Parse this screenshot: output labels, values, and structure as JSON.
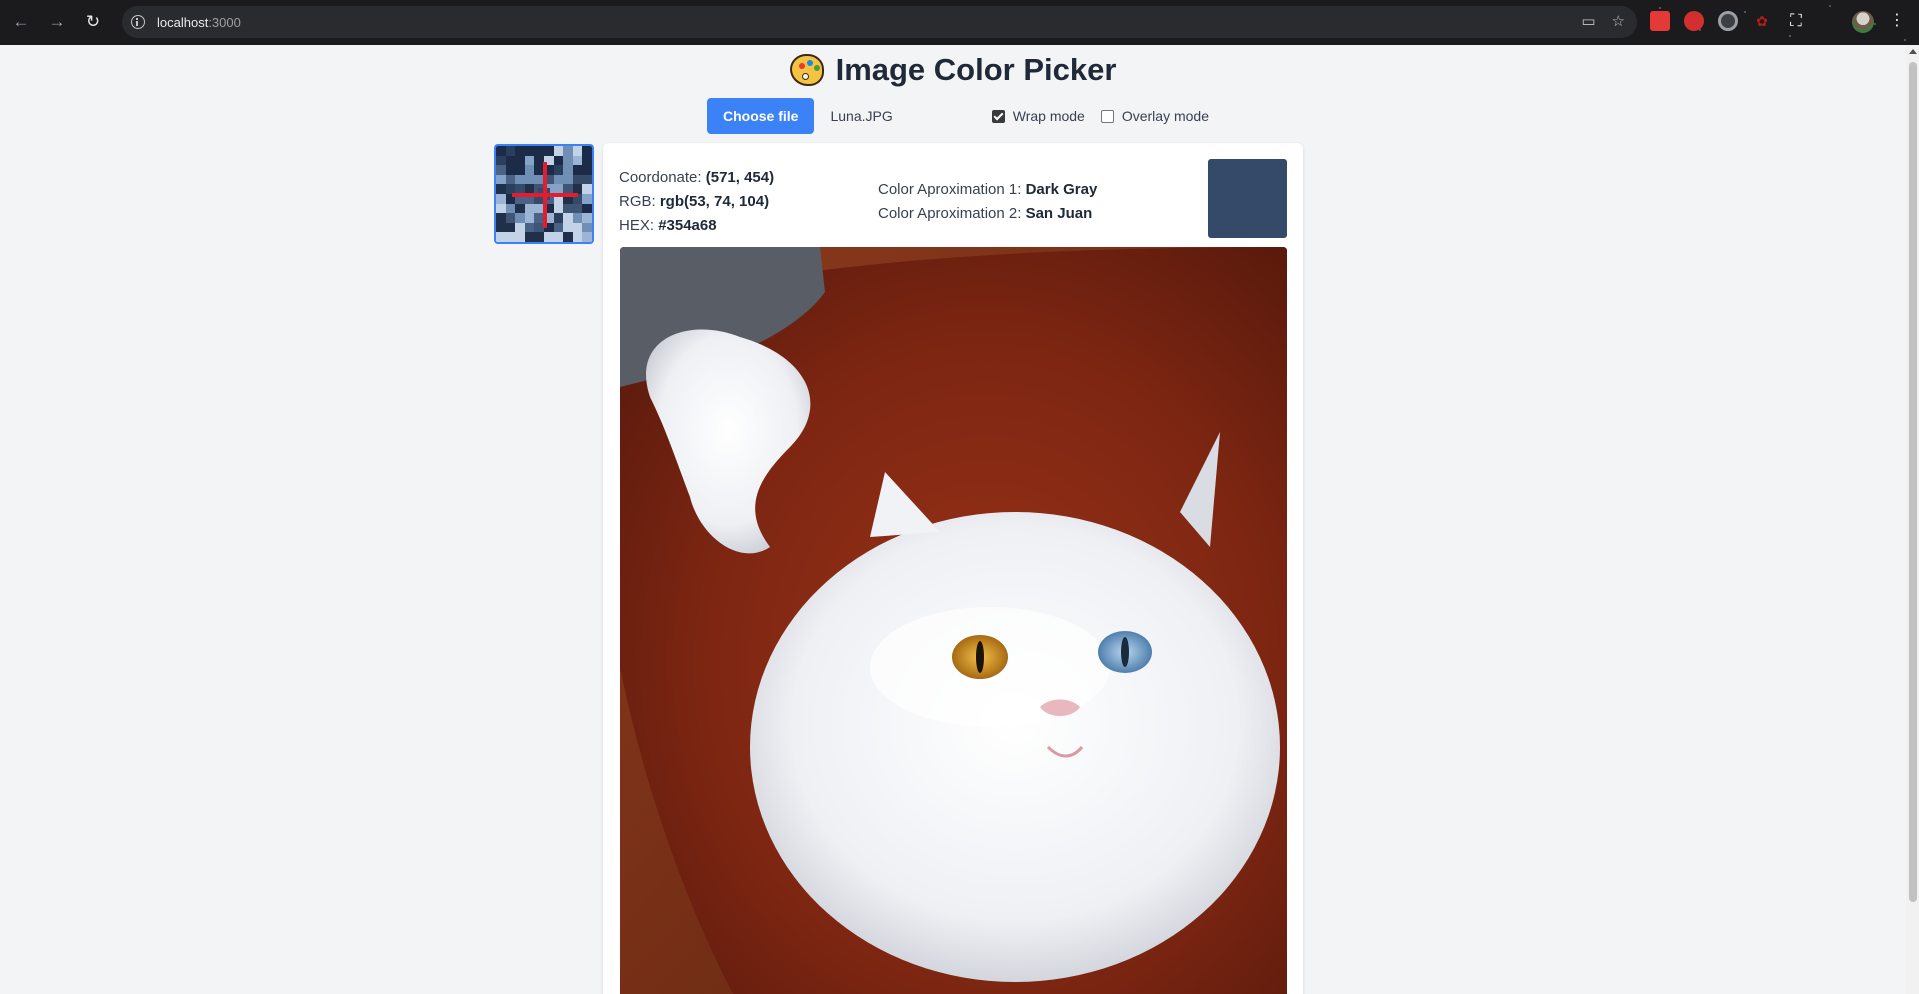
{
  "browser": {
    "url_host": "localhost",
    "url_port": ":3000"
  },
  "app": {
    "title": "Image Color Picker",
    "choose_file_label": "Choose file",
    "file_name": "Luna.JPG",
    "wrap_mode_label": "Wrap mode",
    "wrap_mode_checked": true,
    "overlay_mode_label": "Overlay mode",
    "overlay_mode_checked": false
  },
  "info": {
    "coordinate_label": "Coordonate: ",
    "coordinate_value": "(571, 454)",
    "rgb_label": "RGB: ",
    "rgb_value": "rgb(53, 74, 104)",
    "hex_label": "HEX: ",
    "hex_value": "#354a68",
    "approx1_label": "Color Aproximation 1: ",
    "approx1_value": "Dark Gray",
    "approx2_label": "Color Aproximation 2: ",
    "approx2_value": "San Juan"
  },
  "colors": {
    "picked": "#354a68",
    "accent": "#3b82f6",
    "crosshair": "#e11d2e"
  },
  "icons": {
    "back": "arrow-left-icon",
    "forward": "arrow-right-icon",
    "reload": "reload-icon",
    "site_info": "info-icon",
    "install": "install-app-icon",
    "bookmark": "star-icon",
    "extensions": "puzzle-icon",
    "menu": "kebab-menu-icon",
    "palette": "palette-icon"
  }
}
